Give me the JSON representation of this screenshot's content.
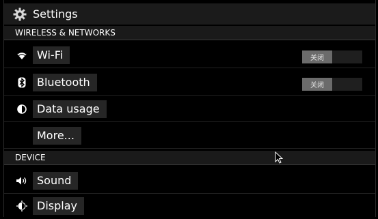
{
  "header": {
    "title": "Settings",
    "icon": "gear-icon"
  },
  "sections": {
    "wireless": {
      "label": "WIRELESS & NETWORKS"
    },
    "device": {
      "label": "DEVICE"
    }
  },
  "items": {
    "wifi": {
      "label": "Wi-Fi",
      "icon": "wifi-icon",
      "toggle": "关闭"
    },
    "bluetooth": {
      "label": "Bluetooth",
      "icon": "bluetooth-icon",
      "toggle": "关闭"
    },
    "data_usage": {
      "label": "Data usage",
      "icon": "data-usage-icon"
    },
    "more": {
      "label": "More..."
    },
    "sound": {
      "label": "Sound",
      "icon": "speaker-icon"
    },
    "display": {
      "label": "Display",
      "icon": "brightness-icon"
    }
  },
  "colors": {
    "background": "#000000",
    "toggle_off": "#6b6b6b",
    "header_bar": "#1b1b1b"
  }
}
